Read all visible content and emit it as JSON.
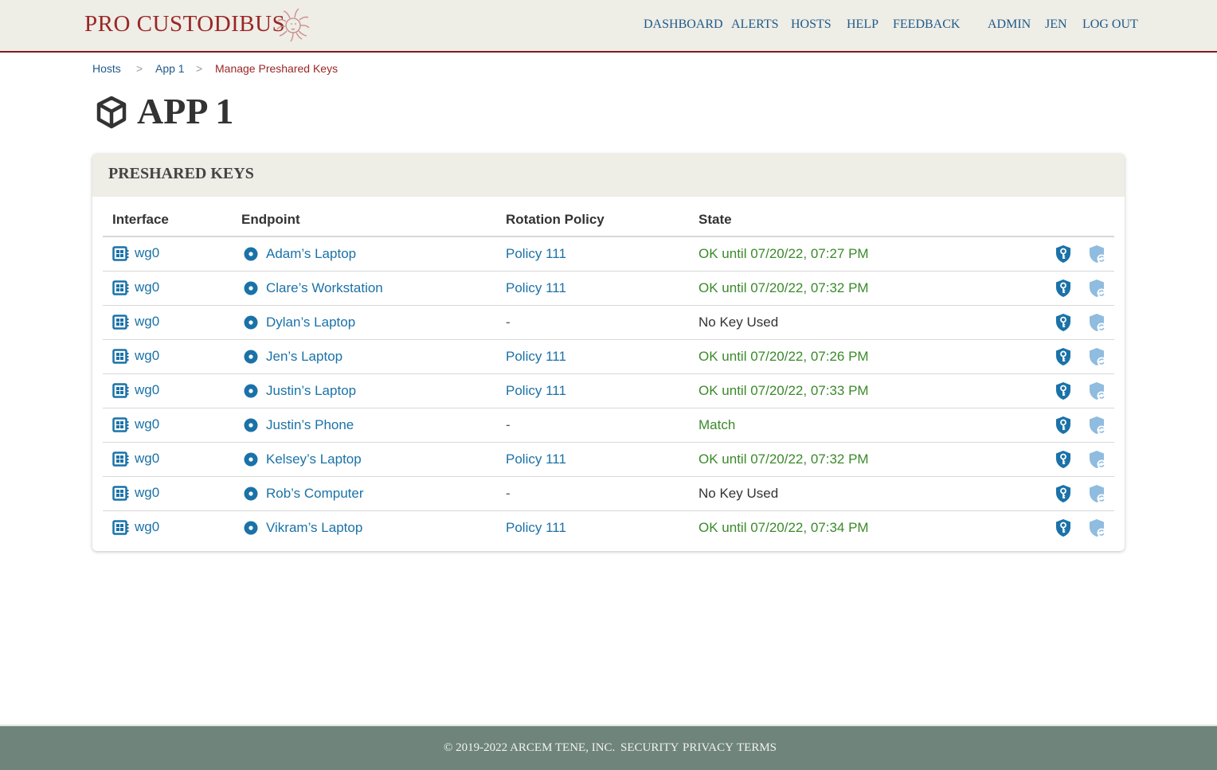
{
  "app": {
    "brand": "PRO CUSTODIBUS",
    "accent_color": "#9a2626",
    "link_color": "#1a72a8",
    "ok_color": "#3a8a2a"
  },
  "nav": {
    "items": [
      {
        "label": "Dashboard",
        "icon": null
      },
      {
        "label": "Alerts",
        "icon": null
      },
      {
        "label": "Hosts",
        "icon": null
      },
      {
        "label": "Help",
        "icon": null
      },
      {
        "label": "Feedback",
        "icon": null
      }
    ],
    "user_items": [
      {
        "label": "Admin"
      },
      {
        "label": "Jen"
      },
      {
        "label": "Log Out"
      }
    ]
  },
  "breadcrumb": {
    "items": [
      "Hosts",
      "App 1"
    ],
    "separator": ">",
    "current": "Manage Preshared Keys"
  },
  "page": {
    "title": "APP 1",
    "title_icon": "cube-icon"
  },
  "panel": {
    "title": "Preshared Keys",
    "columns": [
      "Interface",
      "Endpoint",
      "Rotation Policy",
      "State"
    ],
    "rows": [
      {
        "interface": "wg0",
        "endpoint": "Adam’s Laptop",
        "policy": "Policy 111",
        "state": "OK until 07/20/22, 07:27 PM",
        "state_kind": "ok"
      },
      {
        "interface": "wg0",
        "endpoint": "Clare’s Workstation",
        "policy": "Policy 111",
        "state": "OK until 07/20/22, 07:32 PM",
        "state_kind": "ok"
      },
      {
        "interface": "wg0",
        "endpoint": "Dylan’s Laptop",
        "policy": "-",
        "state": "No Key Used",
        "state_kind": "plain"
      },
      {
        "interface": "wg0",
        "endpoint": "Jen’s Laptop",
        "policy": "Policy 111",
        "state": "OK until 07/20/22, 07:26 PM",
        "state_kind": "ok"
      },
      {
        "interface": "wg0",
        "endpoint": "Justin’s Laptop",
        "policy": "Policy 111",
        "state": "OK until 07/20/22, 07:33 PM",
        "state_kind": "ok"
      },
      {
        "interface": "wg0",
        "endpoint": "Justin’s Phone",
        "policy": "-",
        "state": "Match",
        "state_kind": "ok"
      },
      {
        "interface": "wg0",
        "endpoint": "Kelsey’s Laptop",
        "policy": "Policy 111",
        "state": "OK until 07/20/22, 07:32 PM",
        "state_kind": "ok"
      },
      {
        "interface": "wg0",
        "endpoint": "Rob’s Computer",
        "policy": "-",
        "state": "No Key Used",
        "state_kind": "plain"
      },
      {
        "interface": "wg0",
        "endpoint": "Vikram’s Laptop",
        "policy": "Policy 111",
        "state": "OK until 07/20/22, 07:34 PM",
        "state_kind": "ok"
      }
    ],
    "row_actions": [
      "shield-key-icon",
      "shield-rotate-icon"
    ]
  },
  "footer": {
    "copyright": "© 2019-2022 Arcem Tene, Inc.",
    "links": [
      "Security",
      "Privacy",
      "Terms"
    ]
  }
}
